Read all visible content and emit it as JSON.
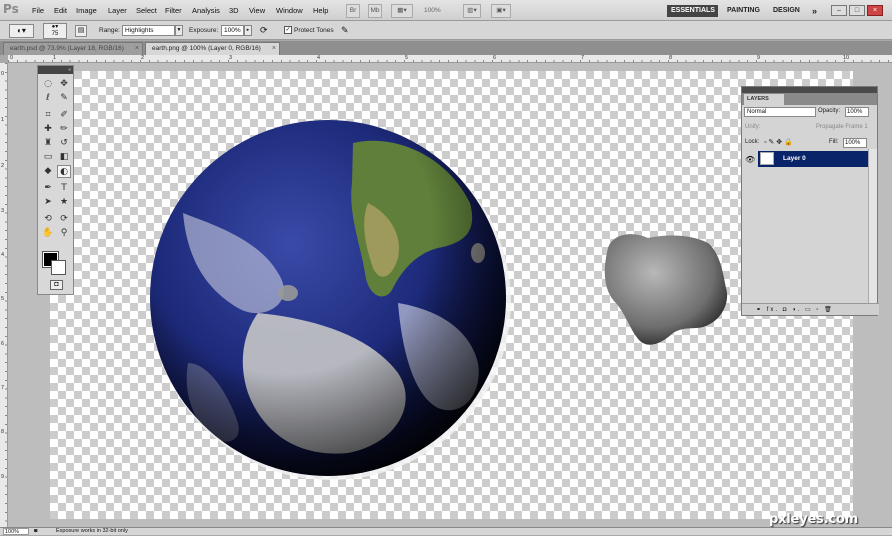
{
  "app": {
    "logo": "Ps"
  },
  "menu": [
    "File",
    "Edit",
    "Image",
    "Layer",
    "Select",
    "Filter",
    "Analysis",
    "3D",
    "View",
    "Window",
    "Help"
  ],
  "menubar": {
    "zoom": "100%",
    "br_label": "Br",
    "mb_label": "Mb"
  },
  "workspaces": {
    "essentials": "ESSENTIALS",
    "painting": "PAINTING",
    "design": "DESIGN",
    "more": "»"
  },
  "window_controls": {
    "minimize": "–",
    "restore": "□",
    "close": "×"
  },
  "options": {
    "brush_size": "75",
    "range_label": "Range:",
    "range_value": "Highlights",
    "exposure_label": "Exposure:",
    "exposure_value": "100%",
    "protect_tones": "Protect Tones"
  },
  "tabs": [
    {
      "label": "earth.psd @ 73.9% (Layer 18, RGB/16)",
      "close": "×"
    },
    {
      "label": "earth.png @ 100% (Layer 0, RGB/16)",
      "close": "×"
    }
  ],
  "ruler": {
    "top": [
      "0",
      "1",
      "2",
      "3",
      "4",
      "5",
      "6",
      "7",
      "8",
      "9",
      "10"
    ],
    "left": [
      "0",
      "1",
      "2",
      "3",
      "4",
      "5",
      "6",
      "7",
      "8",
      "9"
    ]
  },
  "tools_header": "«",
  "tools": [
    {
      "name": "marquee-tool-icon",
      "glyph": "◌"
    },
    {
      "name": "move-tool-icon",
      "glyph": "✥"
    },
    {
      "name": "lasso-tool-icon",
      "glyph": "ℓ"
    },
    {
      "name": "quick-select-tool-icon",
      "glyph": "✎"
    },
    {
      "name": "crop-tool-icon",
      "glyph": "⌗"
    },
    {
      "name": "eyedropper-tool-icon",
      "glyph": "✐"
    },
    {
      "name": "spot-heal-tool-icon",
      "glyph": "✚"
    },
    {
      "name": "brush-tool-icon",
      "glyph": "✏"
    },
    {
      "name": "clone-stamp-tool-icon",
      "glyph": "♜"
    },
    {
      "name": "history-brush-tool-icon",
      "glyph": "↺"
    },
    {
      "name": "eraser-tool-icon",
      "glyph": "▭"
    },
    {
      "name": "gradient-tool-icon",
      "glyph": "◧"
    },
    {
      "name": "blur-tool-icon",
      "glyph": "◆"
    },
    {
      "name": "dodge-tool-icon",
      "glyph": "◐"
    },
    {
      "name": "pen-tool-icon",
      "glyph": "✒"
    },
    {
      "name": "type-tool-icon",
      "glyph": "T"
    },
    {
      "name": "path-select-tool-icon",
      "glyph": "➤"
    },
    {
      "name": "shape-tool-icon",
      "glyph": "★"
    },
    {
      "name": "3d-rotate-tool-icon",
      "glyph": "⟲"
    },
    {
      "name": "3d-camera-tool-icon",
      "glyph": "⟳"
    },
    {
      "name": "hand-tool-icon",
      "glyph": "✋"
    },
    {
      "name": "zoom-tool-icon",
      "glyph": "⚲"
    }
  ],
  "layers_panel": {
    "tab": "LAYERS",
    "blend_mode": "Normal",
    "opacity_label": "Opacity:",
    "opacity_value": "100%",
    "unify_label": "Unify:",
    "propagate_label": "Propagate Frame 1",
    "lock_label": "Lock:",
    "fill_label": "Fill:",
    "fill_value": "100%",
    "layer_name": "Layer 0",
    "footer_icons": "⚭  fx.  ◘  ◑.  ▭  ▫  🗑"
  },
  "status": {
    "zoom": "100%",
    "text": "Exposure works in 32-bit only"
  },
  "watermark": "pxleyes.com"
}
